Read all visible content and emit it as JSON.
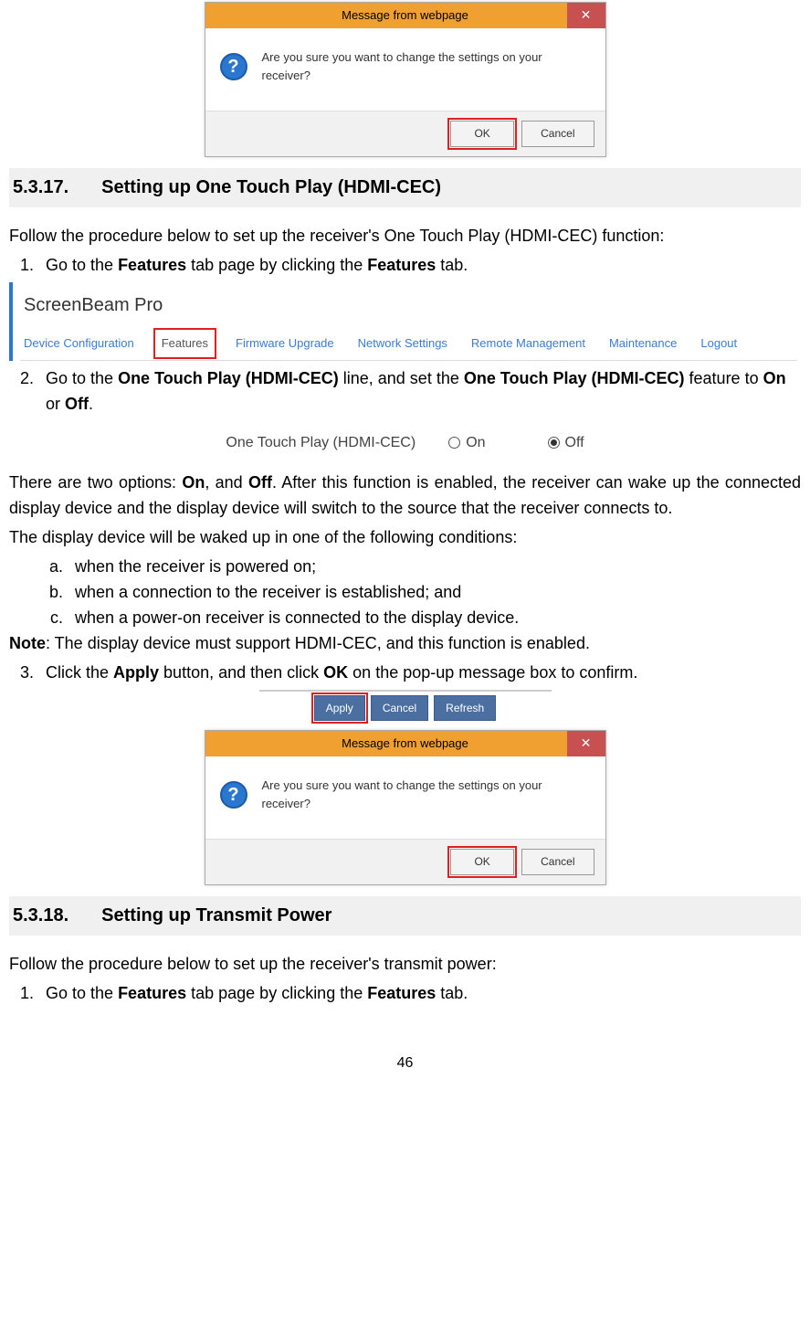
{
  "page_number": "46",
  "dialog1": {
    "title": "Message from webpage",
    "close_glyph": "✕",
    "message": "Are you sure you want to change the settings on your receiver?",
    "ok_label": "OK",
    "cancel_label": "Cancel"
  },
  "section1": {
    "number": "5.3.17.",
    "title": "Setting up One Touch Play (HDMI-CEC)",
    "intro": "Follow the procedure below to set up the receiver's One Touch Play (HDMI-CEC) function:",
    "step1_pre": "Go to the ",
    "step1_b1": "Features",
    "step1_mid": " tab page by clicking the ",
    "step1_b2": "Features",
    "step1_post": " tab.",
    "nav": {
      "product": "ScreenBeam Pro",
      "tabs": [
        "Device Configuration",
        "Features",
        "Firmware Upgrade",
        "Network Settings",
        "Remote Management",
        "Maintenance",
        "Logout"
      ]
    },
    "step2_pre": "Go to the ",
    "step2_b1": "One Touch Play (HDMI-CEC)",
    "step2_mid1": " line, and set the ",
    "step2_b2": "One Touch Play (HDMI-CEC)",
    "step2_mid2": " feature to ",
    "step2_b3": "On",
    "step2_or": " or ",
    "step2_b4": "Off",
    "step2_post": ".",
    "radio": {
      "label": "One Touch Play (HDMI-CEC)",
      "on": "On",
      "off": "Off",
      "selected": "off"
    },
    "para2_pre": "There are two options: ",
    "para2_b1": "On",
    "para2_mid": ", and ",
    "para2_b2": "Off",
    "para2_post": ". After this function is enabled, the receiver can wake up the connected display device and the display device will switch to the source that the receiver connects to.",
    "para3": "The display device will be waked up in one of the following conditions:",
    "cond_a": "when the receiver is powered on;",
    "cond_b": "when a connection to the receiver is established; and",
    "cond_c": "when a power-on receiver is connected to the display device.",
    "note_b": "Note",
    "note_post": ": The display device must support HDMI-CEC, and this function is enabled.",
    "step3_pre": "Click the ",
    "step3_b1": "Apply",
    "step3_mid": " button, and then click ",
    "step3_b2": "OK",
    "step3_post": " on the pop-up message box to confirm.",
    "applybar": {
      "apply": "Apply",
      "cancel": "Cancel",
      "refresh": "Refresh"
    }
  },
  "dialog2": {
    "title": "Message from webpage",
    "close_glyph": "✕",
    "message": "Are you sure you want to change the settings on your receiver?",
    "ok_label": "OK",
    "cancel_label": "Cancel"
  },
  "section2": {
    "number": "5.3.18.",
    "title": "Setting up Transmit Power",
    "intro": "Follow the procedure below to set up the receiver's transmit power:",
    "step1_pre": "Go to the ",
    "step1_b1": "Features",
    "step1_mid": " tab page by clicking the ",
    "step1_b2": "Features",
    "step1_post": " tab."
  }
}
